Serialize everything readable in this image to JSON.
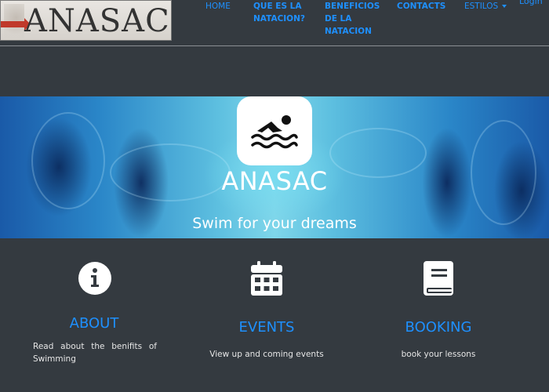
{
  "brand": {
    "logo_text": "ANASAC"
  },
  "nav": {
    "home": "HOME",
    "natacion": "QUE ES LA NATACION?",
    "beneficios": "BENEFICIOS DE LA NATACION",
    "contacts": "CONTACTS",
    "estilos": "ESTILOS",
    "login": "Login"
  },
  "hero": {
    "title": "ANASAC",
    "subtitle": "Swim for your dreams",
    "icon": "swimmer-icon"
  },
  "features": [
    {
      "icon": "info-circle-icon",
      "title": "ABOUT",
      "text": "Read about the benifits of Swimming"
    },
    {
      "icon": "calendar-icon",
      "title": "EVENTS",
      "text": "View up and coming events"
    },
    {
      "icon": "book-icon",
      "title": "BOOKING",
      "text": "book your lessons"
    }
  ],
  "colors": {
    "background": "#343a40",
    "accent": "#1e90ff",
    "hero": "#2a86c8"
  }
}
